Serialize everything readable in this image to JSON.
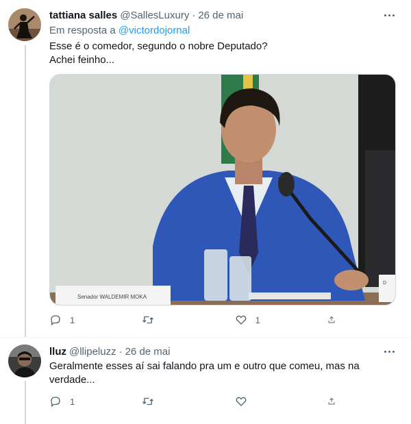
{
  "tweets": [
    {
      "name": "tattiana salles",
      "handle": "@SallesLuxury",
      "dot": "·",
      "date": "26 de mai",
      "reply_prefix": "Em resposta a ",
      "reply_to": "@victordojornal",
      "text_lines": [
        "Esse é o comedor, segundo o nobre Deputado?",
        "Achei feinho..."
      ],
      "media": {
        "placard": "Senador WALDEMIR MOKA",
        "placard_right": "D"
      },
      "stats": {
        "reply": "1",
        "retweet": "",
        "like": "1"
      },
      "icons": [
        "reply-icon",
        "retweet-icon",
        "like-icon",
        "share-icon"
      ]
    },
    {
      "name": "lluz",
      "handle": "@llipeluzz",
      "dot": "·",
      "date": "26 de mai",
      "text_lines": [
        "Geralmente esses aí sai falando pra um e outro que comeu, mas na",
        "verdade..."
      ],
      "stats": {
        "reply": "1",
        "retweet": "",
        "like": ""
      },
      "icons": [
        "reply-icon",
        "retweet-icon",
        "like-icon",
        "share-icon"
      ]
    }
  ],
  "colors": {
    "link": "#1d9bf0",
    "secondary_text": "#536471",
    "primary_text": "#0f1419",
    "thread_line": "#cfd9de"
  }
}
